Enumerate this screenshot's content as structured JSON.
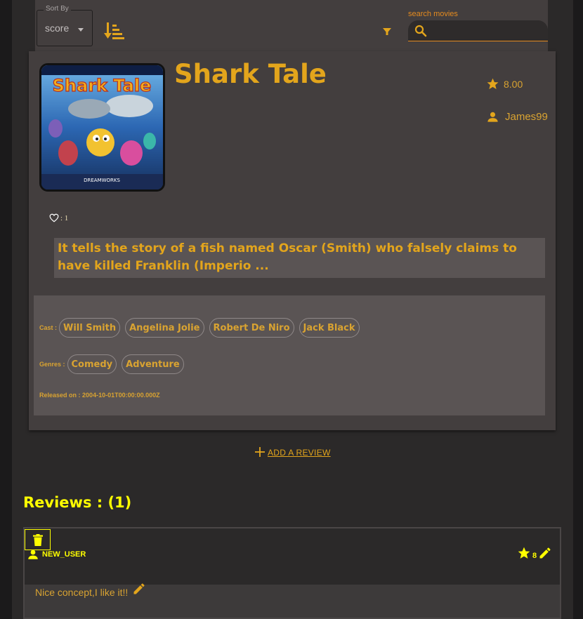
{
  "toolbar": {
    "sort_label": "Sort By",
    "sort_value": "score",
    "search_label": "search movies",
    "search_value": ""
  },
  "movie": {
    "title": "Shark Tale",
    "poster_title": "Shark Tale",
    "poster_brand": "DREAMWORKS",
    "score": "8.00",
    "user": "James99",
    "likes": ": 1",
    "description": "It tells the story of a fish named Oscar (Smith) who falsely claims to have killed Franklin (Imperio ...",
    "cast_label": "Cast :",
    "cast": [
      "Will Smith",
      "Angelina Jolie",
      "Robert De Niro",
      "Jack Black"
    ],
    "genres_label": "Genres :",
    "genres": [
      "Comedy",
      "Adventure"
    ],
    "released_label": "Released on :",
    "released": "2004-10-01T00:00:00.000Z"
  },
  "add_review_label": "ADD A REVIEW",
  "reviews": {
    "heading": "Reviews : (1)",
    "items": [
      {
        "user": "NEW_USER",
        "rating": "8",
        "text": "Nice concept,I like it!!"
      }
    ]
  },
  "colors": {
    "accent": "#e3a51c",
    "review_accent": "#ffff00",
    "search_accent": "#e58b1f",
    "card_bg": "#433e3e",
    "page_bg": "#2b2929"
  },
  "icons": [
    "sort-direction-icon",
    "filter-icon",
    "search-icon",
    "star-icon",
    "person-icon",
    "heart-icon",
    "plus-icon",
    "trash-icon",
    "pencil-icon"
  ]
}
